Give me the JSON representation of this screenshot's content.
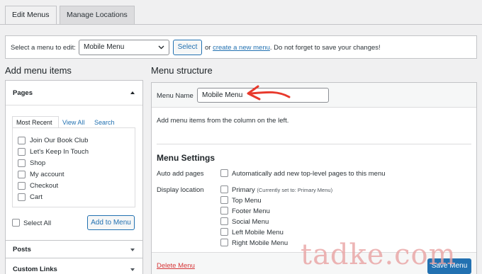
{
  "tabs": {
    "edit": "Edit Menus",
    "manage": "Manage Locations"
  },
  "select_bar": {
    "prompt": "Select a menu to edit:",
    "selected": "Mobile Menu",
    "select_button": "Select",
    "or_text": "or",
    "create_link": "create a new menu",
    "suffix": ". Do not forget to save your changes!"
  },
  "left": {
    "heading": "Add menu items",
    "pages": {
      "title": "Pages",
      "tabs": [
        "Most Recent",
        "View All",
        "Search"
      ],
      "items": [
        "Join Our Book Club",
        "Let's Keep In Touch",
        "Shop",
        "My account",
        "Checkout",
        "Cart"
      ],
      "select_all": "Select All",
      "add_button": "Add to Menu"
    },
    "posts_title": "Posts",
    "custom_links_title": "Custom Links"
  },
  "right": {
    "heading": "Menu structure",
    "menu_name_label": "Menu Name",
    "menu_name_value": "Mobile Menu",
    "instructions": "Add menu items from the column on the left.",
    "settings_title": "Menu Settings",
    "auto_add_label": "Auto add pages",
    "auto_add_option": "Automatically add new top-level pages to this menu",
    "display_location_label": "Display location",
    "locations": [
      {
        "name": "Primary",
        "note": "(Currently set to: Primary Menu)"
      },
      {
        "name": "Top Menu",
        "note": ""
      },
      {
        "name": "Footer Menu",
        "note": ""
      },
      {
        "name": "Social Menu",
        "note": ""
      },
      {
        "name": "Left Mobile Menu",
        "note": ""
      },
      {
        "name": "Right Mobile Menu",
        "note": ""
      }
    ],
    "delete_link": "Delete Menu",
    "save_button": "Save Menu"
  },
  "watermark": "tadke.com",
  "colors": {
    "accent": "#2271b1",
    "delete": "#d63638",
    "annotation_arrow": "#e8392c"
  }
}
